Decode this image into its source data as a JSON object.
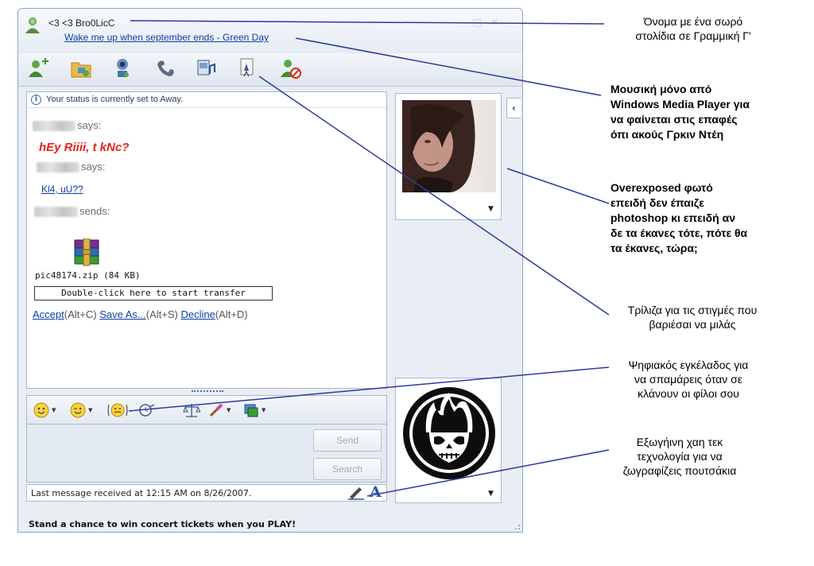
{
  "window": {
    "contact_name": "<3 <3 Bro0LicC",
    "now_playing": "Wake me up when september ends - Green Day"
  },
  "toolbar": {
    "icons": [
      "invite-contact-icon",
      "send-files-icon",
      "webcam-icon",
      "voice-call-icon",
      "activities-icon",
      "games-icon",
      "block-contact-icon"
    ]
  },
  "conversation": {
    "status_notice": "Your status is currently set to Away.",
    "says_1": "says:",
    "message_1": "hEy Riiii, t kNc?",
    "says_2": "says:",
    "message_2": "Kl4, uU??",
    "sends": "sends:",
    "file_name": "pic48174.zip (84 KB)",
    "transfer_prompt": "Double-click here to start transfer",
    "accept_link": "Accept",
    "accept_shortcut": "(Alt+C)",
    "save_as_link": "Save As...",
    "save_as_shortcut": "(Alt+S)",
    "decline_link": "Decline",
    "decline_shortcut": "(Alt+D)"
  },
  "compose": {
    "send_label": "Send",
    "search_label": "Search"
  },
  "status_bar": {
    "last_message": "Last message received at 12:15 AM on 8/26/2007."
  },
  "ad_bar": {
    "text": "Stand a chance to win concert tickets when you PLAY!"
  },
  "colors": {
    "accent": "#0b3fa8",
    "message_red": "#e2241b",
    "annotation_line": "#2b3aa0"
  },
  "annotations": [
    {
      "line1": "Όνομα με ένα σωρό",
      "line2": "στολίδια σε Γραμμική Γ'"
    },
    {
      "line1": "Μουσική μόνο από",
      "line2": "Windows Media Player για",
      "line3": "να φαίνεται στις επαφές",
      "line4": "όπι ακούς Γρκιν Ντέη"
    },
    {
      "line1": "Overexposed φωτό",
      "line2": "επειδή δεν έπαιζε",
      "line3": "photoshop κι επειδή αν",
      "line4": "δε τα έκανες τότε, πότε θα",
      "line5": "τα έκανες, τώρα;"
    },
    {
      "line1": "Τρίλιζα για τις στιγμές που",
      "line2": "βαριέσαι να μιλάς"
    },
    {
      "line1": "Ψηφιακός εγκέλαδος για",
      "line2": "να σπαμάρεις όταν σε",
      "line3": "κλάνουν οι φίλοι σου"
    },
    {
      "line1": "Εξωγήινη χαη τεκ",
      "line2": "τεχνολογία για να",
      "line3": "ζωγραφίζεις πουτσάκια"
    }
  ]
}
